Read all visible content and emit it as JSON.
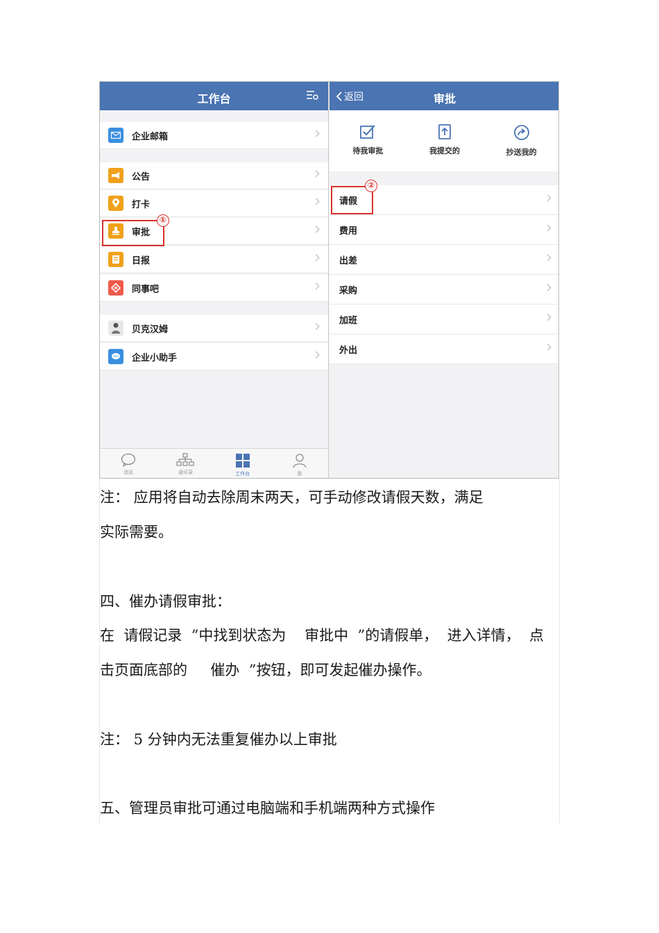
{
  "left_panel": {
    "title": "工作台",
    "items": [
      {
        "label": "企业邮箱",
        "icon": "mail-icon",
        "color": "#3b8fe0"
      },
      {
        "label": "公告",
        "icon": "megaphone-icon",
        "color": "#f0a11c"
      },
      {
        "label": "打卡",
        "icon": "location-pin-icon",
        "color": "#f0a11c"
      },
      {
        "label": "审批",
        "icon": "stamp-icon",
        "color": "#f0a11c"
      },
      {
        "label": "日报",
        "icon": "report-icon",
        "color": "#f0a11c"
      },
      {
        "label": "同事吧",
        "icon": "community-icon",
        "color": "#ef5a4c"
      },
      {
        "label": "贝克汉姆",
        "icon": "avatar-icon",
        "color": "#888888"
      },
      {
        "label": "企业小助手",
        "icon": "chat-bubble-icon",
        "color": "#3b8fe0"
      }
    ],
    "tabs": [
      {
        "label": "消息",
        "icon": "message-icon"
      },
      {
        "label": "通讯录",
        "icon": "org-chart-icon"
      },
      {
        "label": "工作台",
        "icon": "grid-icon",
        "active": true
      },
      {
        "label": "我",
        "icon": "person-icon"
      }
    ],
    "marker": "①"
  },
  "right_panel": {
    "back_label": "返回",
    "title": "审批",
    "actions": [
      {
        "label": "待我审批",
        "icon": "check-square-icon"
      },
      {
        "label": "我提交的",
        "icon": "upload-doc-icon"
      },
      {
        "label": "抄送我的",
        "icon": "forward-circle-icon"
      }
    ],
    "items": [
      "请假",
      "费用",
      "出差",
      "采购",
      "加班",
      "外出"
    ],
    "marker": "②"
  },
  "document": {
    "lines": [
      "注： 应用将自动去除周末两天，可手动修改请假天数，满足",
      "实际需要。",
      "四、催办请假审批：",
      "在  请假记录  ”中找到状态为    审批中  ”的请假单，  进入详情，  点",
      "击页面底部的     催办  ”按钮，即可发起催办操作。",
      "注： 5 分钟内无法重复催办以上审批",
      "五、管理员审批可通过电脑端和手机端两种方式操作"
    ]
  },
  "colors": {
    "header_blue": "#4a74b2",
    "highlight_red": "#d9312b"
  }
}
